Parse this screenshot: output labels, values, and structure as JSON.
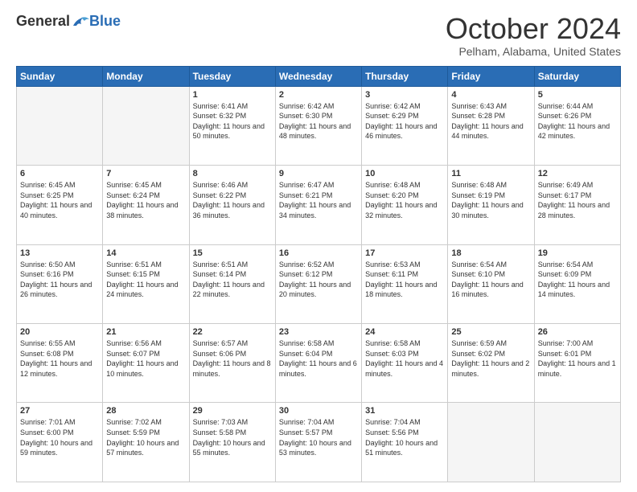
{
  "logo": {
    "general": "General",
    "blue": "Blue"
  },
  "header": {
    "month": "October 2024",
    "location": "Pelham, Alabama, United States"
  },
  "days": [
    "Sunday",
    "Monday",
    "Tuesday",
    "Wednesday",
    "Thursday",
    "Friday",
    "Saturday"
  ],
  "weeks": [
    [
      {
        "day": "",
        "info": ""
      },
      {
        "day": "",
        "info": ""
      },
      {
        "day": "1",
        "info": "Sunrise: 6:41 AM\nSunset: 6:32 PM\nDaylight: 11 hours and 50 minutes."
      },
      {
        "day": "2",
        "info": "Sunrise: 6:42 AM\nSunset: 6:30 PM\nDaylight: 11 hours and 48 minutes."
      },
      {
        "day": "3",
        "info": "Sunrise: 6:42 AM\nSunset: 6:29 PM\nDaylight: 11 hours and 46 minutes."
      },
      {
        "day": "4",
        "info": "Sunrise: 6:43 AM\nSunset: 6:28 PM\nDaylight: 11 hours and 44 minutes."
      },
      {
        "day": "5",
        "info": "Sunrise: 6:44 AM\nSunset: 6:26 PM\nDaylight: 11 hours and 42 minutes."
      }
    ],
    [
      {
        "day": "6",
        "info": "Sunrise: 6:45 AM\nSunset: 6:25 PM\nDaylight: 11 hours and 40 minutes."
      },
      {
        "day": "7",
        "info": "Sunrise: 6:45 AM\nSunset: 6:24 PM\nDaylight: 11 hours and 38 minutes."
      },
      {
        "day": "8",
        "info": "Sunrise: 6:46 AM\nSunset: 6:22 PM\nDaylight: 11 hours and 36 minutes."
      },
      {
        "day": "9",
        "info": "Sunrise: 6:47 AM\nSunset: 6:21 PM\nDaylight: 11 hours and 34 minutes."
      },
      {
        "day": "10",
        "info": "Sunrise: 6:48 AM\nSunset: 6:20 PM\nDaylight: 11 hours and 32 minutes."
      },
      {
        "day": "11",
        "info": "Sunrise: 6:48 AM\nSunset: 6:19 PM\nDaylight: 11 hours and 30 minutes."
      },
      {
        "day": "12",
        "info": "Sunrise: 6:49 AM\nSunset: 6:17 PM\nDaylight: 11 hours and 28 minutes."
      }
    ],
    [
      {
        "day": "13",
        "info": "Sunrise: 6:50 AM\nSunset: 6:16 PM\nDaylight: 11 hours and 26 minutes."
      },
      {
        "day": "14",
        "info": "Sunrise: 6:51 AM\nSunset: 6:15 PM\nDaylight: 11 hours and 24 minutes."
      },
      {
        "day": "15",
        "info": "Sunrise: 6:51 AM\nSunset: 6:14 PM\nDaylight: 11 hours and 22 minutes."
      },
      {
        "day": "16",
        "info": "Sunrise: 6:52 AM\nSunset: 6:12 PM\nDaylight: 11 hours and 20 minutes."
      },
      {
        "day": "17",
        "info": "Sunrise: 6:53 AM\nSunset: 6:11 PM\nDaylight: 11 hours and 18 minutes."
      },
      {
        "day": "18",
        "info": "Sunrise: 6:54 AM\nSunset: 6:10 PM\nDaylight: 11 hours and 16 minutes."
      },
      {
        "day": "19",
        "info": "Sunrise: 6:54 AM\nSunset: 6:09 PM\nDaylight: 11 hours and 14 minutes."
      }
    ],
    [
      {
        "day": "20",
        "info": "Sunrise: 6:55 AM\nSunset: 6:08 PM\nDaylight: 11 hours and 12 minutes."
      },
      {
        "day": "21",
        "info": "Sunrise: 6:56 AM\nSunset: 6:07 PM\nDaylight: 11 hours and 10 minutes."
      },
      {
        "day": "22",
        "info": "Sunrise: 6:57 AM\nSunset: 6:06 PM\nDaylight: 11 hours and 8 minutes."
      },
      {
        "day": "23",
        "info": "Sunrise: 6:58 AM\nSunset: 6:04 PM\nDaylight: 11 hours and 6 minutes."
      },
      {
        "day": "24",
        "info": "Sunrise: 6:58 AM\nSunset: 6:03 PM\nDaylight: 11 hours and 4 minutes."
      },
      {
        "day": "25",
        "info": "Sunrise: 6:59 AM\nSunset: 6:02 PM\nDaylight: 11 hours and 2 minutes."
      },
      {
        "day": "26",
        "info": "Sunrise: 7:00 AM\nSunset: 6:01 PM\nDaylight: 11 hours and 1 minute."
      }
    ],
    [
      {
        "day": "27",
        "info": "Sunrise: 7:01 AM\nSunset: 6:00 PM\nDaylight: 10 hours and 59 minutes."
      },
      {
        "day": "28",
        "info": "Sunrise: 7:02 AM\nSunset: 5:59 PM\nDaylight: 10 hours and 57 minutes."
      },
      {
        "day": "29",
        "info": "Sunrise: 7:03 AM\nSunset: 5:58 PM\nDaylight: 10 hours and 55 minutes."
      },
      {
        "day": "30",
        "info": "Sunrise: 7:04 AM\nSunset: 5:57 PM\nDaylight: 10 hours and 53 minutes."
      },
      {
        "day": "31",
        "info": "Sunrise: 7:04 AM\nSunset: 5:56 PM\nDaylight: 10 hours and 51 minutes."
      },
      {
        "day": "",
        "info": ""
      },
      {
        "day": "",
        "info": ""
      }
    ]
  ]
}
